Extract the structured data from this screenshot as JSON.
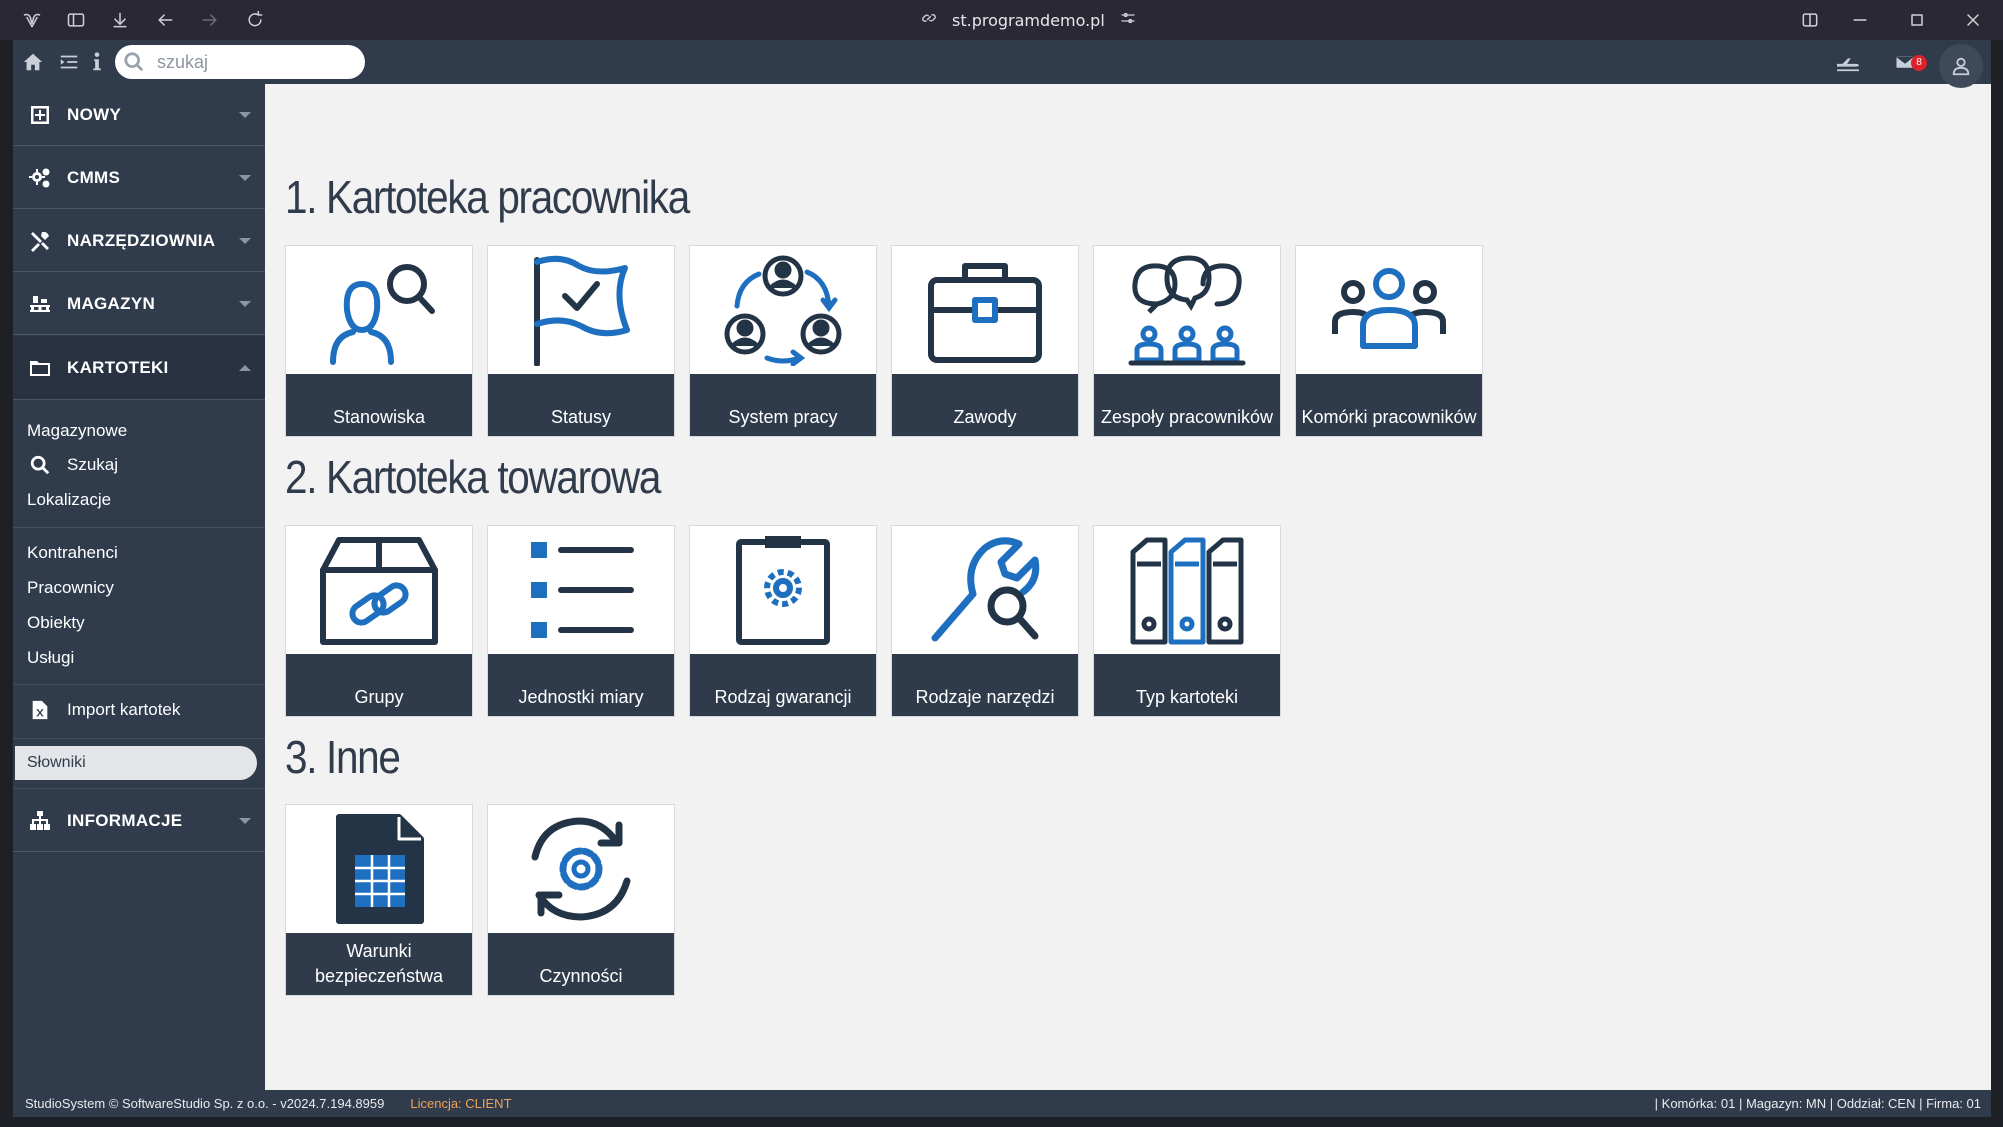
{
  "browser": {
    "url": "st.programdemo.pl"
  },
  "search": {
    "placeholder": "szukaj"
  },
  "notifications": {
    "mail_count": "8"
  },
  "sidebar": {
    "sections": [
      {
        "label": "NOWY",
        "icon": "plus-square-icon"
      },
      {
        "label": "CMMS",
        "icon": "gears-icon"
      },
      {
        "label": "NARZĘDZIOWNIA",
        "icon": "tools-icon"
      },
      {
        "label": "MAGAZYN",
        "icon": "pallet-icon"
      },
      {
        "label": "KARTOTEKI",
        "icon": "folder-icon"
      },
      {
        "label": "INFORMACJE",
        "icon": "sitemap-icon"
      }
    ],
    "kartoteki_items": {
      "magazynowe": "Magazynowe",
      "szukaj": "Szukaj",
      "lokalizacje": "Lokalizacje",
      "kontrahenci": "Kontrahenci",
      "pracownicy": "Pracownicy",
      "obiekty": "Obiekty",
      "uslugi": "Usługi",
      "import": "Import kartotek",
      "slowniki": "Słowniki"
    }
  },
  "main": {
    "groups": [
      {
        "title": "1. Kartoteka pracownika",
        "tiles": [
          "Stanowiska",
          "Statusy",
          "System pracy",
          "Zawody",
          "Zespoły pracowników",
          "Komórki pracowników"
        ]
      },
      {
        "title": "2. Kartoteka towarowa",
        "tiles": [
          "Grupy",
          "Jednostki miary",
          "Rodzaj gwarancji",
          "Rodzaje narzędzi",
          "Typ kartoteki"
        ]
      },
      {
        "title": "3. Inne",
        "tiles": [
          "Warunki bezpieczeństwa",
          "Czynności"
        ]
      }
    ]
  },
  "footer": {
    "copyright": "StudioSystem © SoftwareStudio Sp. z o.o. - v2024.7.194.8959",
    "license": "Licencja: CLIENT",
    "context": "| Komórka: 01 | Magazyn: MN | Oddział: CEN | Firma: 01"
  },
  "colors": {
    "sidebar_bg": "#303b4b",
    "tile_label_bg": "#2f3b4b",
    "icon_dark": "#243447",
    "icon_blue": "#1e6fc0",
    "license_text": "#f0a25a",
    "badge_red": "#e0202a"
  }
}
